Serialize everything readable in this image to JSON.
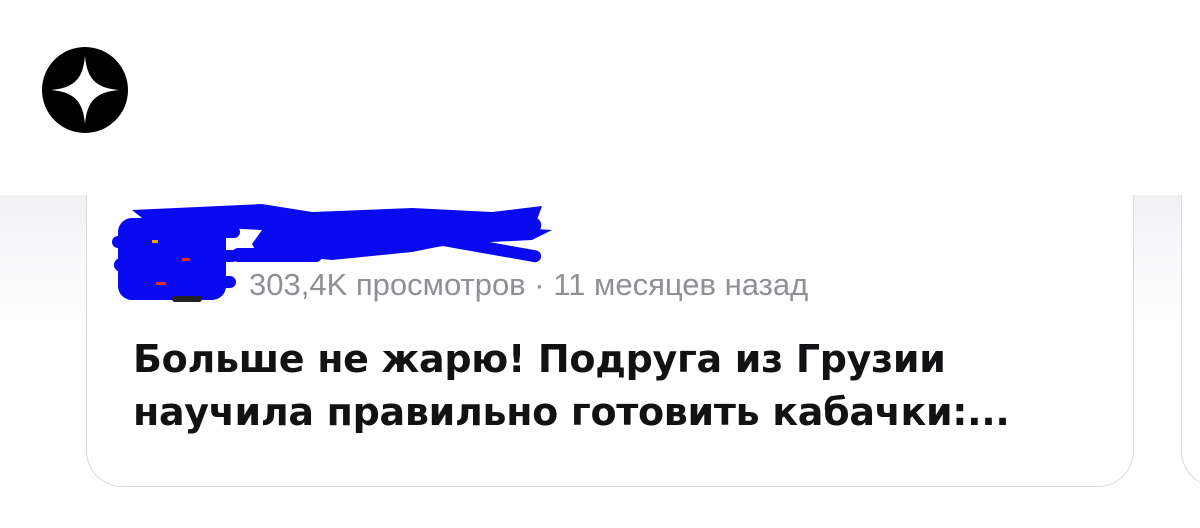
{
  "brand": {
    "logo_icon": "star-four-point-icon",
    "logo_color": "#000000"
  },
  "article": {
    "author": {
      "avatar_icon": "avatar-redacted",
      "channel_name_redacted": true,
      "redaction_color": "#0a0af0"
    },
    "views": "303,4K просмотров",
    "separator": "·",
    "age": "11 месяцев назад",
    "title_line1": "Больше не жарю! Подруга из Грузии",
    "title_line2": "научила правильно готовить кабачки:..."
  }
}
